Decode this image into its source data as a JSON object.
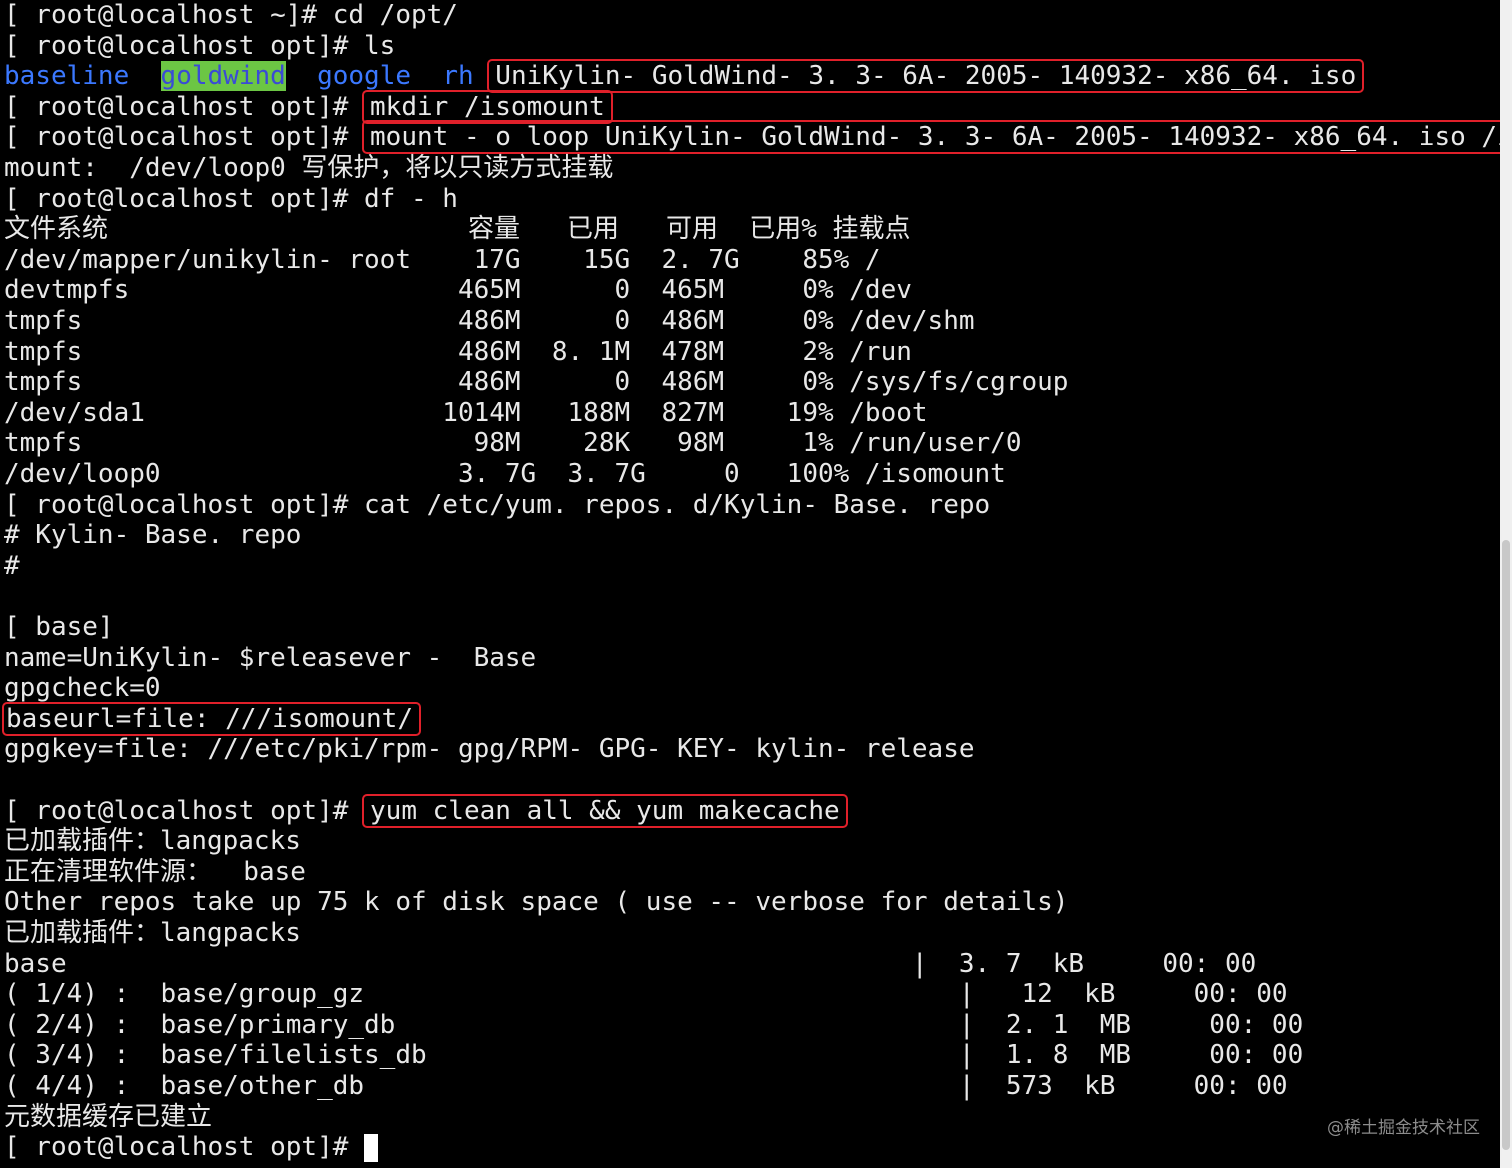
{
  "lines": {
    "l0": "[ root@localhost ~]# cd /opt/",
    "l1": "[ root@localhost opt]# ls",
    "l3_prompt": "[ root@localhost opt]# ",
    "l3_cmd": "mkdir /isomount",
    "l4_prompt": "[ root@localhost opt]# ",
    "l4_cmd": "mount - o loop UniKylin- GoldWind- 3. 3- 6A- 2005- 140932- x86_64. iso /isomount/",
    "l5": "mount:  /dev/loop0 写保护，将以只读方式挂载",
    "l6": "[ root@localhost opt]# df - h",
    "l7": "文件系统                       容量   已用   可用  已用% 挂载点",
    "l8": "/dev/mapper/unikylin- root    17G    15G  2. 7G    85% /",
    "l9": "devtmpfs                     465M      0  465M     0% /dev",
    "l10": "tmpfs                        486M      0  486M     0% /dev/shm",
    "l11": "tmpfs                        486M  8. 1M  478M     2% /run",
    "l12": "tmpfs                        486M      0  486M     0% /sys/fs/cgroup",
    "l13": "/dev/sda1                   1014M   188M  827M    19% /boot",
    "l14": "tmpfs                         98M    28K   98M     1% /run/user/0",
    "l15": "/dev/loop0                   3. 7G  3. 7G     0   100% /isomount",
    "l16": "[ root@localhost opt]# cat /etc/yum. repos. d/Kylin- Base. repo",
    "l17": "# Kylin- Base. repo",
    "l18": "#",
    "l20": "[ base]",
    "l21": "name=UniKylin- $releasever -  Base",
    "l22": "gpgcheck=0",
    "l23": "baseurl=file: ///isomount/",
    "l24": "gpgkey=file: ///etc/pki/rpm- gpg/RPM- GPG- KEY- kylin- release",
    "l26_prompt": "[ root@localhost opt]# ",
    "l26_cmd": "yum clean all && yum makecache",
    "l27": "已加载插件：langpacks",
    "l28": "正在清理软件源：  base",
    "l29": "Other repos take up 75 k of disk space ( use -- verbose for details)",
    "l30": "已加载插件：langpacks",
    "l31": "base                                                      |  3. 7  kB     00: 00",
    "l32": "( 1/4) :  base/group_gz                                      |   12  kB     00: 00",
    "l33": "( 2/4) :  base/primary_db                                    |  2. 1  MB     00: 00",
    "l34": "( 3/4) :  base/filelists_db                                  |  1. 8  MB     00: 00",
    "l35": "( 4/4) :  base/other_db                                      |  573  kB     00: 00",
    "l36": "元数据缓存已建立",
    "l37_prompt": "[ root@localhost opt]# "
  },
  "ls_output": {
    "baseline": "baseline",
    "goldwind": "goldwind",
    "google": "google",
    "rh": "rh",
    "iso": "UniKylin- GoldWind- 3. 3- 6A- 2005- 140932- x86_64. iso"
  },
  "watermark": "@稀土掘金技术社区",
  "colors": {
    "background": "#000000",
    "text": "#e8e8e8",
    "dir_blue": "#3b78ff",
    "highlight_green": "#6cc644",
    "annotation_red": "#e0202a"
  }
}
